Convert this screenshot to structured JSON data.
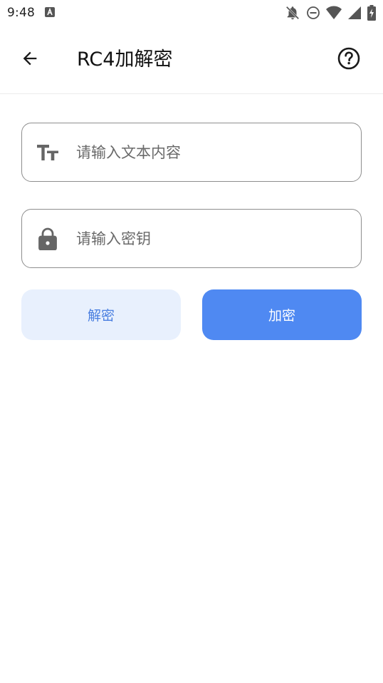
{
  "status_bar": {
    "time": "9:48",
    "icons": [
      "app-notification-icon",
      "bell-off-icon",
      "do-not-disturb-icon",
      "wifi-icon",
      "signal-icon",
      "battery-charging-icon"
    ]
  },
  "app_bar": {
    "title": "RC4加解密",
    "back_icon": "arrow-back-icon",
    "help_icon": "help-circle-icon"
  },
  "form": {
    "text_field": {
      "value": "",
      "placeholder": "请输入文本内容",
      "icon": "text-size-icon"
    },
    "key_field": {
      "value": "",
      "placeholder": "请输入密钥",
      "icon": "lock-icon"
    }
  },
  "actions": {
    "decrypt_label": "解密",
    "encrypt_label": "加密"
  },
  "colors": {
    "primary": "#4f89f2",
    "primary_light": "#e8f0fd",
    "primary_text": "#4a7fe0",
    "border": "#8e8e8e"
  }
}
